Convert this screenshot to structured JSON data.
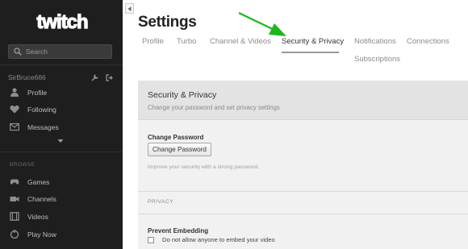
{
  "sidebar": {
    "logo_text": "twitch",
    "search": {
      "placeholder": "Search"
    },
    "username": "SirBruce666",
    "user_actions": [
      {
        "icon": "wrench-icon"
      },
      {
        "icon": "logout-icon"
      }
    ],
    "main_nav": [
      {
        "label": "Profile",
        "icon": "person-icon"
      },
      {
        "label": "Following",
        "icon": "heart-icon"
      },
      {
        "label": "Messages",
        "icon": "envelope-icon"
      }
    ],
    "expand_icon": "chevron-down-icon",
    "browse_heading": "BROWSE",
    "browse_nav": [
      {
        "label": "Games",
        "icon": "gamepad-icon"
      },
      {
        "label": "Channels",
        "icon": "camera-icon"
      },
      {
        "label": "Videos",
        "icon": "film-icon"
      },
      {
        "label": "Play Now",
        "icon": "play-now-icon"
      }
    ]
  },
  "main": {
    "collapse_icon": "chevron-left-icon",
    "title": "Settings",
    "tabs": [
      {
        "label": "Profile",
        "active": false
      },
      {
        "label": "Turbo",
        "active": false
      },
      {
        "label": "Channel & Videos",
        "active": false
      },
      {
        "label": "Security & Privacy",
        "active": true
      },
      {
        "label": "Notifications",
        "active": false
      },
      {
        "label": "Connections",
        "active": false
      },
      {
        "label": "Subscriptions",
        "active": false
      }
    ],
    "section": {
      "title": "Security & Privacy",
      "subtitle": "Change your password and set privacy settings"
    },
    "password": {
      "label": "Change Password",
      "button": "Change Password",
      "hint": "Improve your security with a strong password."
    },
    "privacy": {
      "heading": "PRIVACY",
      "embed_label": "Prevent Embedding",
      "embed_checkbox": "Do not allow anyone to embed your video",
      "embed_checked": false
    }
  },
  "colors": {
    "sidebar_bg": "#1e1e1e",
    "annotation_arrow": "#1fb51f",
    "panel_header_bg": "#e3e3e3",
    "panel_bg": "#f1f1f1"
  }
}
